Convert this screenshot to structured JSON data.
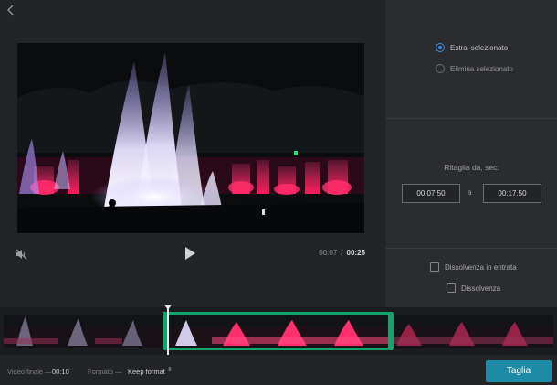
{
  "player": {
    "time_current": "00:07",
    "time_separator": "/",
    "time_total": "00:25"
  },
  "options": {
    "extract_label": "Estrai selezionato",
    "delete_label": "Elimina selezionato",
    "selected": "extract"
  },
  "trim": {
    "label": "Ritaglia da, sec:",
    "start": "00:07.50",
    "to_label": "a",
    "end": "00:17.50"
  },
  "fades": {
    "fade_in_label": "Dissolvenza in entrata",
    "fade_out_label": "Dissolvenza"
  },
  "footer": {
    "final_label": "Video finale —",
    "final_value": "00:10",
    "format_label": "Formato —",
    "format_value": "Keep format",
    "format_caret": "⇕",
    "cut_button": "Taglia"
  },
  "icons": {
    "back": "chevron-left-icon",
    "mute": "speaker-muted-icon",
    "play": "play-icon"
  },
  "colors": {
    "accent_radio": "#3b8ee8",
    "selection_handle": "#14a36b",
    "primary_button": "#1d8ba5"
  }
}
